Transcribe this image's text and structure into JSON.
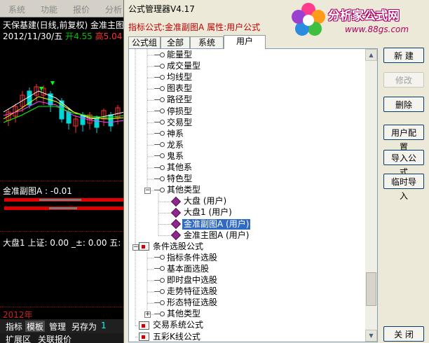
{
  "background_app": {
    "menu": [
      "系统",
      "功能",
      "报价",
      "分析"
    ],
    "stock_line": "天保基建(日线,前复权) 金准主图",
    "date_line": {
      "date": "2012/11/30/五",
      "open_label": "开",
      "open": "4.55",
      "high_label": "高",
      "high": "5.04",
      "low_label": "低"
    },
    "indicator_line": "金准副图A : -0.01",
    "dapan_line": "大盘1  上证: 0.00  _±: 0.00  五:",
    "year_label": "2012年",
    "tabs": [
      "指标",
      "模板",
      "管理",
      "另存为",
      "1"
    ],
    "bottom_tabs": [
      "扩展区",
      "关联报价"
    ]
  },
  "dialog": {
    "title": "公式管理器V4.17",
    "info": "指标公式:金准副图A  属性:用户公式",
    "tabs": [
      "公式组",
      "全部",
      "系统",
      "用户"
    ],
    "active_tab": "用户",
    "tree": [
      {
        "label": "能量型",
        "level": 1,
        "icon": "key"
      },
      {
        "label": "成交量型",
        "level": 1,
        "icon": "key"
      },
      {
        "label": "均线型",
        "level": 1,
        "icon": "key"
      },
      {
        "label": "图表型",
        "level": 1,
        "icon": "key"
      },
      {
        "label": "路径型",
        "level": 1,
        "icon": "key"
      },
      {
        "label": "停损型",
        "level": 1,
        "icon": "key"
      },
      {
        "label": "交易型",
        "level": 1,
        "icon": "key"
      },
      {
        "label": "神系",
        "level": 1,
        "icon": "key"
      },
      {
        "label": "龙系",
        "level": 1,
        "icon": "key"
      },
      {
        "label": "鬼系",
        "level": 1,
        "icon": "key"
      },
      {
        "label": "其他系",
        "level": 1,
        "icon": "key"
      },
      {
        "label": "特色型",
        "level": 1,
        "icon": "key"
      },
      {
        "label": "其他类型",
        "level": 1,
        "icon": "key",
        "expander": "−"
      },
      {
        "label": "大盘    (用户)",
        "level": 2,
        "icon": "gem"
      },
      {
        "label": "大盘1    (用户)",
        "level": 2,
        "icon": "gem"
      },
      {
        "label": "金准副图A    (用户)",
        "level": 2,
        "icon": "gem",
        "selected": true
      },
      {
        "label": "金准主图A    (用户)",
        "level": 2,
        "icon": "gem"
      },
      {
        "label": "条件选股公式",
        "level": 0,
        "icon": "folder",
        "expander": "−"
      },
      {
        "label": "指标条件选股",
        "level": 1,
        "icon": "key"
      },
      {
        "label": "基本面选股",
        "level": 1,
        "icon": "key"
      },
      {
        "label": "即时盘中选股",
        "level": 1,
        "icon": "key"
      },
      {
        "label": "走势特征选股",
        "level": 1,
        "icon": "key"
      },
      {
        "label": "形态特征选股",
        "level": 1,
        "icon": "key"
      },
      {
        "label": "其他类型",
        "level": 1,
        "icon": "key",
        "expander": "+"
      },
      {
        "label": "交易系统公式",
        "level": 0,
        "icon": "folder"
      },
      {
        "label": "五彩K线公式",
        "level": 0,
        "icon": "folder"
      }
    ],
    "buttons": {
      "new": "新 建",
      "modify": "修改",
      "delete": "删除",
      "user_config": "用户配置",
      "import": "导入公式",
      "temp_import": "临时导入",
      "close": "关 闭"
    },
    "scroll_position": 0.9
  },
  "logo": {
    "text": "分析家公式网",
    "url": "www.88gs.com"
  },
  "colors": {
    "selection": "#316ac5",
    "info_text": "#c00000",
    "dialog_bg": "#ece9d8"
  }
}
